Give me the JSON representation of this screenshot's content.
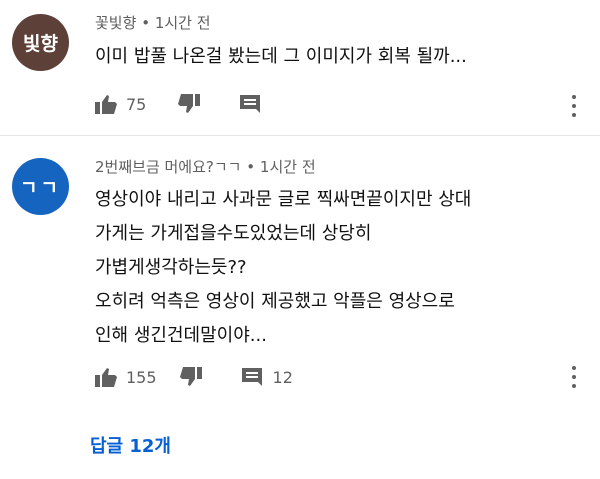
{
  "comments": [
    {
      "avatar_text": "빛향",
      "avatar_color": "#5d4037",
      "author": "꽃빛향",
      "time": "1시간 전",
      "lines": [
        "이미 밥풀 나온걸 봤는데 그 이미지가 회복 될까..."
      ],
      "likes": "75",
      "reply_count": ""
    },
    {
      "avatar_text": "ㄱㄱ",
      "avatar_color": "#1565c0",
      "author": "2번째브금 머에요?ㄱㄱ",
      "time": "1시간 전",
      "lines": [
        "영상이야 내리고 사과문 글로 찍싸면끝이지만 상대",
        "가게는 가게접을수도있었는데  상당히",
        "가볍게생각하는듯??",
        "오히려 억측은 영상이 제공했고 악플은 영상으로",
        "인해 생긴건데말이야..."
      ],
      "likes": "155",
      "reply_count": "12"
    }
  ],
  "separator": "•",
  "replies_label": "답글 12개",
  "icons": {
    "like": "thumbs-up-icon",
    "dislike": "thumbs-down-icon",
    "reply": "comment-icon",
    "more": "more-vert-icon"
  },
  "colors": {
    "meta": "#606060",
    "link": "#065fd4"
  }
}
